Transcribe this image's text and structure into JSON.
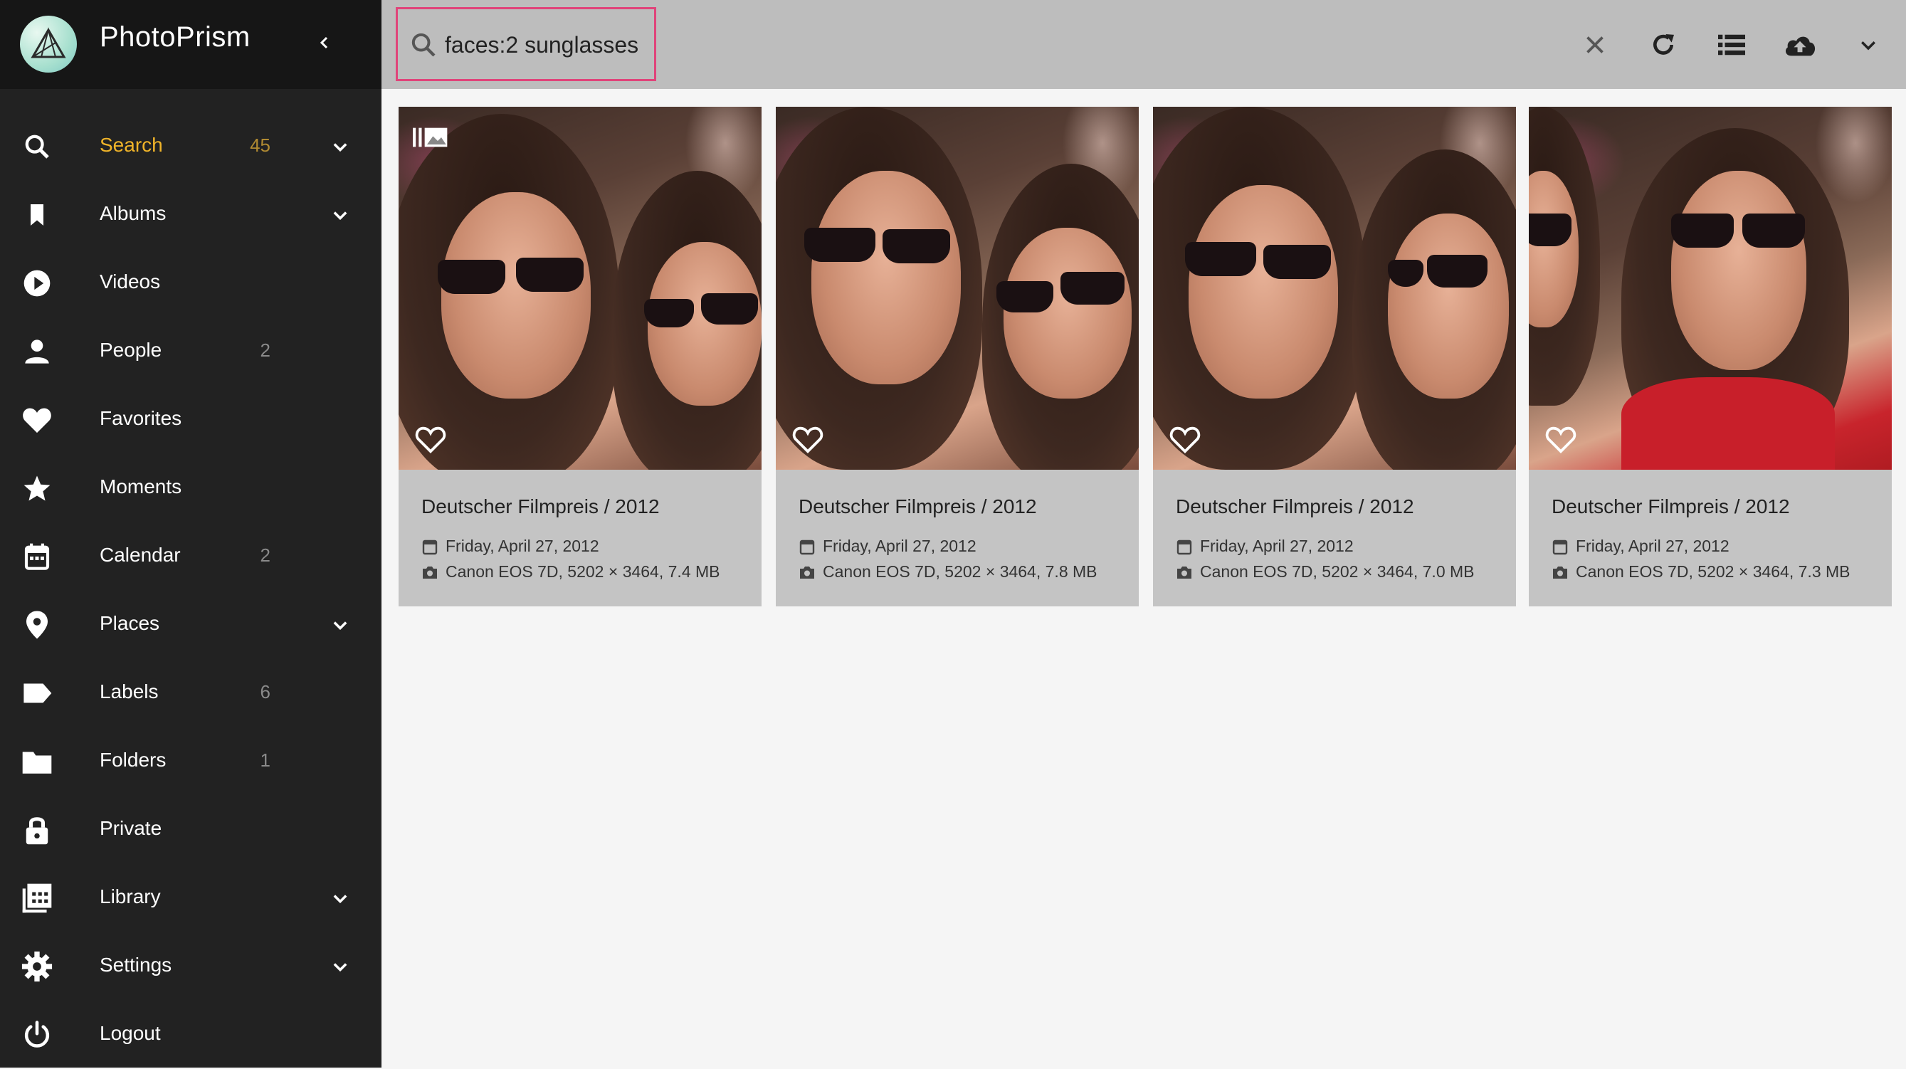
{
  "app": {
    "name": "PhotoPrism"
  },
  "colors": {
    "sidebar_bg": "#222222",
    "topbar_bg": "#bdbdbd",
    "accent_active": "#f0b429",
    "search_highlight": "#e0447a"
  },
  "sidebar": {
    "items": [
      {
        "label": "Search",
        "count": "45",
        "icon": "search-icon",
        "expandable": true,
        "active": true
      },
      {
        "label": "Albums",
        "count": "",
        "icon": "bookmark-icon",
        "expandable": true,
        "active": false
      },
      {
        "label": "Videos",
        "count": "",
        "icon": "play-circle-icon",
        "expandable": false,
        "active": false
      },
      {
        "label": "People",
        "count": "2",
        "icon": "person-icon",
        "expandable": false,
        "active": false
      },
      {
        "label": "Favorites",
        "count": "",
        "icon": "heart-icon",
        "expandable": false,
        "active": false
      },
      {
        "label": "Moments",
        "count": "",
        "icon": "star-icon",
        "expandable": false,
        "active": false
      },
      {
        "label": "Calendar",
        "count": "2",
        "icon": "calendar-icon",
        "expandable": false,
        "active": false
      },
      {
        "label": "Places",
        "count": "",
        "icon": "map-pin-icon",
        "expandable": true,
        "active": false
      },
      {
        "label": "Labels",
        "count": "6",
        "icon": "label-icon",
        "expandable": false,
        "active": false
      },
      {
        "label": "Folders",
        "count": "1",
        "icon": "folder-icon",
        "expandable": false,
        "active": false
      },
      {
        "label": "Private",
        "count": "",
        "icon": "lock-icon",
        "expandable": false,
        "active": false
      },
      {
        "label": "Library",
        "count": "",
        "icon": "library-icon",
        "expandable": true,
        "active": false
      },
      {
        "label": "Settings",
        "count": "",
        "icon": "gear-icon",
        "expandable": true,
        "active": false
      },
      {
        "label": "Logout",
        "count": "",
        "icon": "power-icon",
        "expandable": false,
        "active": false
      }
    ]
  },
  "toolbar": {
    "search_value": "faces:2 sunglasses",
    "buttons": [
      "clear-icon",
      "refresh-icon",
      "list-view-icon",
      "upload-icon",
      "chevron-down-icon"
    ]
  },
  "photos": [
    {
      "title": "Deutscher Filmpreis / 2012",
      "date": "Friday, April 27, 2012",
      "camera": "Canon EOS 7D, 5202 × 3464, 7.4 MB",
      "stack": true
    },
    {
      "title": "Deutscher Filmpreis / 2012",
      "date": "Friday, April 27, 2012",
      "camera": "Canon EOS 7D, 5202 × 3464, 7.8 MB",
      "stack": false
    },
    {
      "title": "Deutscher Filmpreis / 2012",
      "date": "Friday, April 27, 2012",
      "camera": "Canon EOS 7D, 5202 × 3464, 7.0 MB",
      "stack": false
    },
    {
      "title": "Deutscher Filmpreis / 2012",
      "date": "Friday, April 27, 2012",
      "camera": "Canon EOS 7D, 5202 × 3464, 7.3 MB",
      "stack": false
    }
  ]
}
